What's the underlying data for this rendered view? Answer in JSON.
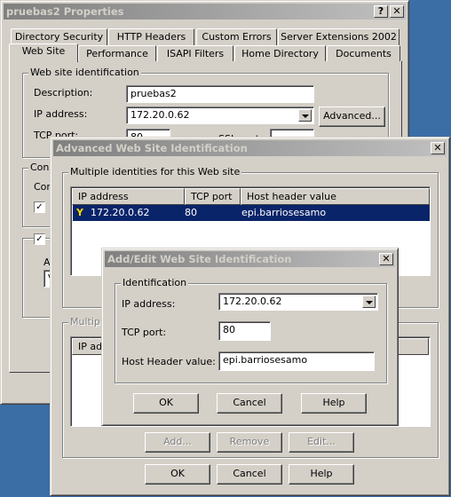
{
  "main": {
    "title": "pruebas2 Properties",
    "help_btn": "?",
    "close_btn": "✕",
    "tabs_row1": [
      "Directory Security",
      "HTTP Headers",
      "Custom Errors",
      "Server Extensions 2002"
    ],
    "tabs_row2": [
      "Web Site",
      "Performance",
      "ISAPI Filters",
      "Home Directory",
      "Documents"
    ],
    "active_tab": "Web Site",
    "group_identification": "Web site identification",
    "description_label": "Description:",
    "description_value": "pruebas2",
    "ip_label": "IP address:",
    "ip_value": "172.20.0.62",
    "advanced_btn": "Advanced...",
    "tcp_label": "TCP port:",
    "tcp_value": "80",
    "ssl_label": "SSL port:",
    "conn_group": "Conn",
    "conn_label": "Cor",
    "a_label": "A",
    "v_value": "V"
  },
  "advanced": {
    "title": "Advanced Web Site Identification",
    "close_btn": "✕",
    "group1": "Multiple identities for this Web site",
    "columns": [
      "IP address",
      "TCP port",
      "Host header value"
    ],
    "rows": [
      {
        "ip": "172.20.0.62",
        "port": "80",
        "host": "epi.barriosesamo",
        "selected": true
      }
    ],
    "group2": "Multiple",
    "group2_col": "IP add",
    "add_btn": "Add...",
    "remove_btn": "Remove",
    "edit_btn": "Edit...",
    "ok_btn": "OK",
    "cancel_btn": "Cancel",
    "help_btn": "Help"
  },
  "addedit": {
    "title": "Add/Edit Web Site Identification",
    "close_btn": "✕",
    "group": "Identification",
    "ip_label": "IP address:",
    "ip_value": "172.20.0.62",
    "tcp_label": "TCP port:",
    "tcp_value": "80",
    "host_label": "Host Header value:",
    "host_value": "epi.barriosesamo",
    "ok_btn": "OK",
    "cancel_btn": "Cancel",
    "help_btn": "Help"
  },
  "colors": {
    "desktop": "#3a6ea5",
    "selection": "#0a246a",
    "face": "#d4d0c8"
  }
}
